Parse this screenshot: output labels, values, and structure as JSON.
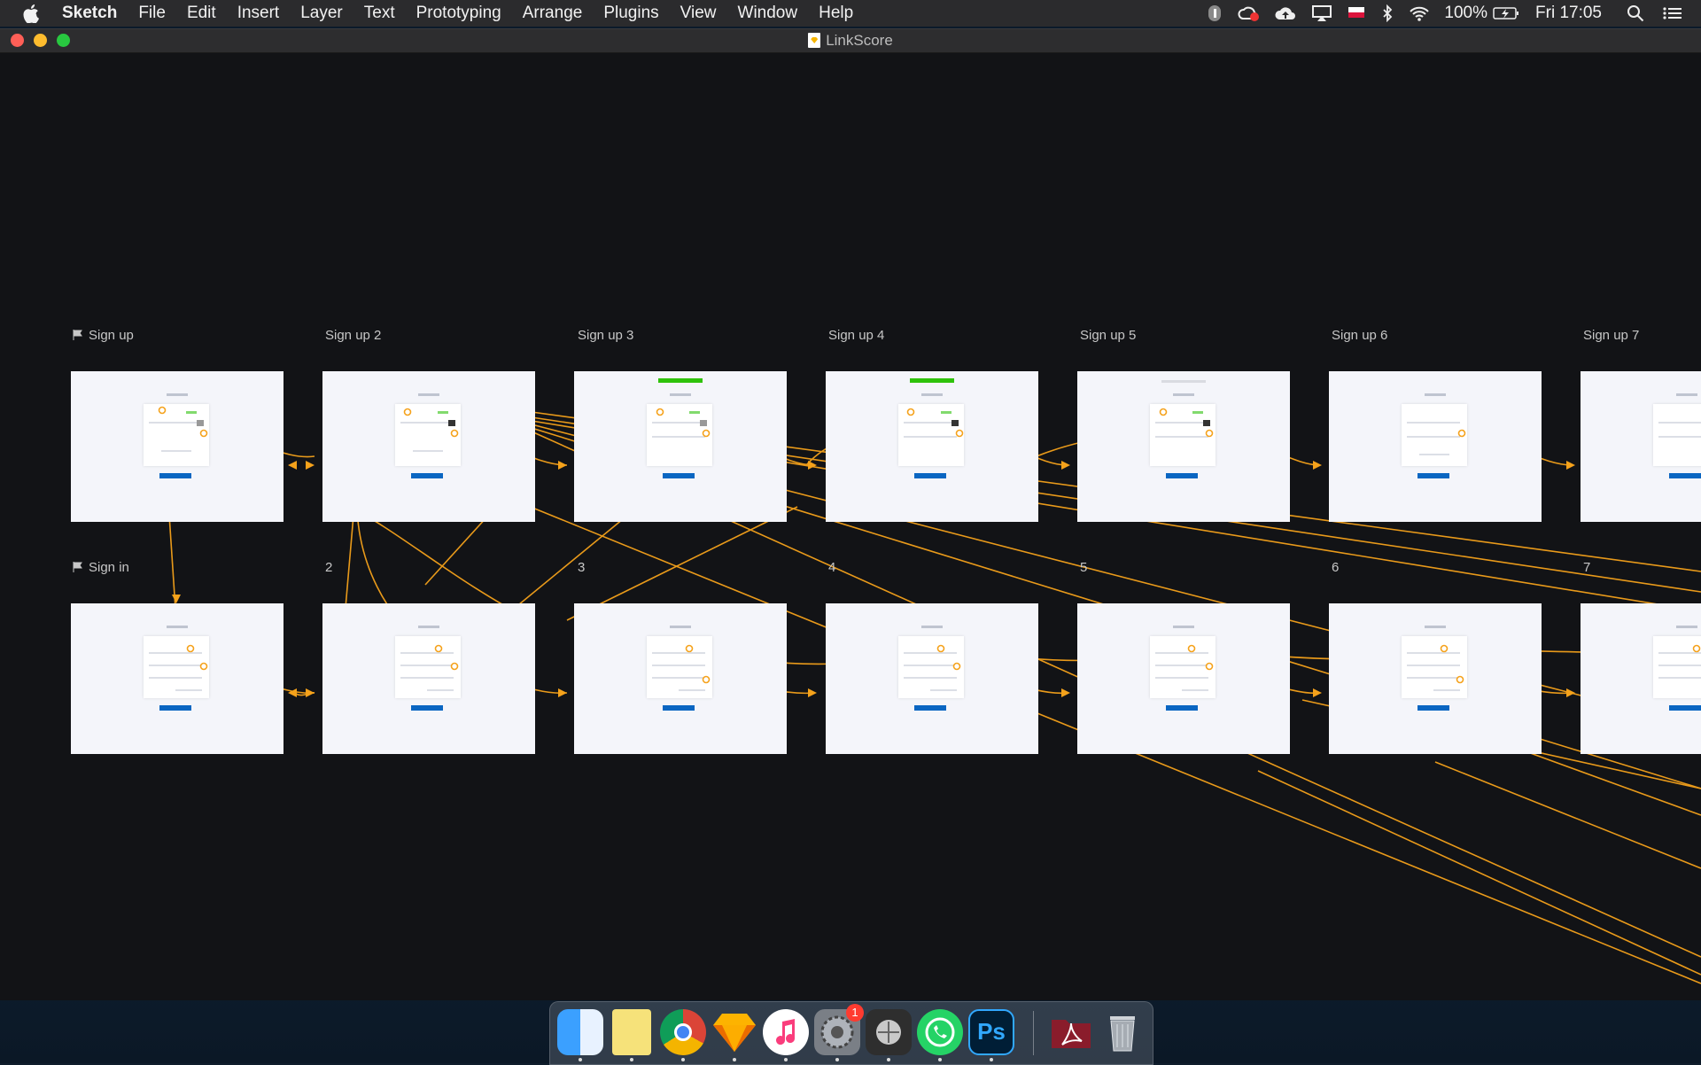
{
  "menubar": {
    "app_name": "Sketch",
    "items": [
      "File",
      "Edit",
      "Insert",
      "Layer",
      "Text",
      "Prototyping",
      "Arrange",
      "Plugins",
      "View",
      "Window",
      "Help"
    ],
    "status": {
      "battery": "100%",
      "clock": "Fri 17:05"
    },
    "icons": [
      "apple-icon",
      "1password-icon",
      "creative-cloud-icon",
      "cloud-upload-icon",
      "airplay-icon",
      "flag-icon",
      "bluetooth-icon",
      "wifi-icon",
      "battery-icon",
      "search-icon",
      "notification-center-icon"
    ]
  },
  "window": {
    "title": "LinkScore"
  },
  "artboards": {
    "top": [
      {
        "label": "Sign up",
        "flag": true
      },
      {
        "label": "Sign up 2"
      },
      {
        "label": "Sign up 3"
      },
      {
        "label": "Sign up 4"
      },
      {
        "label": "Sign up 5"
      },
      {
        "label": "Sign up 6"
      },
      {
        "label": "Sign up 7"
      }
    ],
    "bottom": [
      {
        "label": "Sign in",
        "flag": true
      },
      {
        "label": "2"
      },
      {
        "label": "3"
      },
      {
        "label": "4"
      },
      {
        "label": "5"
      },
      {
        "label": "6"
      },
      {
        "label": "7"
      }
    ]
  },
  "colors": {
    "link": "#f5a21b",
    "canvas": "#121316",
    "artboard": "#f4f5fa",
    "linkedin": "#0a66c2"
  },
  "dock": {
    "apps": [
      "Finder",
      "Notes",
      "Chrome",
      "Sketch",
      "iTunes",
      "System Preferences",
      "Compressor",
      "WhatsApp",
      "Photoshop",
      "Downloads",
      "Trash"
    ],
    "badges": {
      "System Preferences": "1"
    },
    "ps_label": "Ps"
  }
}
